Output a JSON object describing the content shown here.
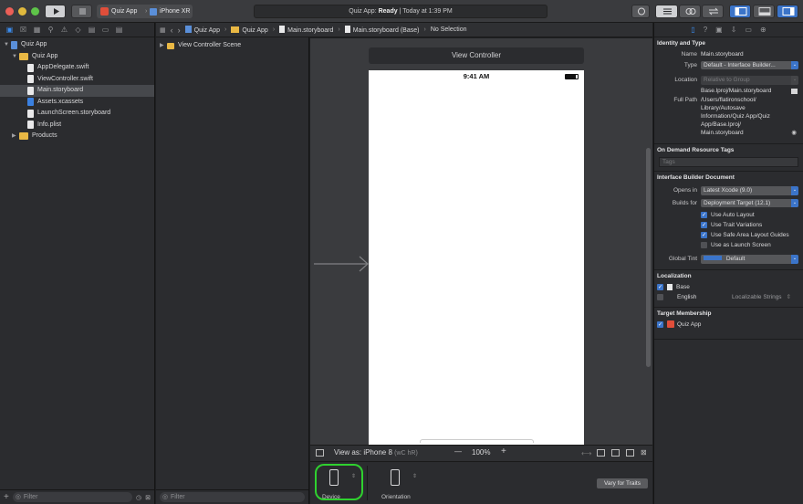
{
  "toolbar": {
    "scheme_target": "Quiz App",
    "device": "iPhone XR",
    "status_app": "Quiz App:",
    "status_state": "Ready",
    "status_time": "| Today at 1:39 PM"
  },
  "navigator": {
    "items": [
      {
        "label": "Quiz App",
        "kind": "project",
        "level": 0,
        "expanded": true
      },
      {
        "label": "Quiz App",
        "kind": "folder",
        "level": 1,
        "expanded": true
      },
      {
        "label": "AppDelegate.swift",
        "kind": "swift",
        "level": 2
      },
      {
        "label": "ViewController.swift",
        "kind": "swift",
        "level": 2
      },
      {
        "label": "Main.storyboard",
        "kind": "storyboard",
        "level": 2,
        "selected": true
      },
      {
        "label": "Assets.xcassets",
        "kind": "assets",
        "level": 2
      },
      {
        "label": "LaunchScreen.storyboard",
        "kind": "storyboard",
        "level": 2
      },
      {
        "label": "Info.plist",
        "kind": "plist",
        "level": 2
      },
      {
        "label": "Products",
        "kind": "folder",
        "level": 1,
        "expanded": false
      }
    ],
    "filter_placeholder": "Filter"
  },
  "jumpbar": {
    "crumbs": [
      "Quiz App",
      "Quiz App",
      "Main.storyboard",
      "Main.storyboard (Base)",
      "No Selection"
    ]
  },
  "outline": {
    "scene": "View Controller Scene",
    "filter_placeholder": "Filter"
  },
  "canvas": {
    "vc_title": "View Controller",
    "status_time": "9:41 AM"
  },
  "viewas": {
    "label": "View as: iPhone 8",
    "traits": "(wC hR)",
    "zoom": "100%",
    "minus": "—",
    "plus": "+"
  },
  "devicebar": {
    "device_label": "Device",
    "orientation_label": "Orientation",
    "vary_button": "Vary for Traits"
  },
  "inspector": {
    "identity_title": "Identity and Type",
    "name_label": "Name",
    "name_value": "Main.storyboard",
    "type_label": "Type",
    "type_value": "Default - Interface Builder...",
    "location_label": "Location",
    "location_value": "Relative to Group",
    "location_path": "Base.lproj/Main.storyboard",
    "fullpath_label": "Full Path",
    "fullpath_lines": [
      "/Users/flatironschool/",
      "Library/Autosave",
      "Information/Quiz App/Quiz",
      "App/Base.lproj/",
      "Main.storyboard"
    ],
    "odr_title": "On Demand Resource Tags",
    "tags_placeholder": "Tags",
    "ibd_title": "Interface Builder Document",
    "opens_in_label": "Opens in",
    "opens_in_value": "Latest Xcode (9.0)",
    "builds_for_label": "Builds for",
    "builds_for_value": "Deployment Target (12.1)",
    "checks": [
      {
        "label": "Use Auto Layout",
        "checked": true
      },
      {
        "label": "Use Trait Variations",
        "checked": true
      },
      {
        "label": "Use Safe Area Layout Guides",
        "checked": true
      },
      {
        "label": "Use as Launch Screen",
        "checked": false
      }
    ],
    "global_tint_label": "Global Tint",
    "global_tint_value": "Default",
    "loc_title": "Localization",
    "loc_base": "Base",
    "loc_english": "English",
    "loc_english_value": "Localizable Strings",
    "membership_title": "Target Membership",
    "membership_target": "Quiz App"
  },
  "colors": {
    "accent": "#3b74c9",
    "highlight_ring": "#2fd12f",
    "folder": "#e9b844"
  }
}
